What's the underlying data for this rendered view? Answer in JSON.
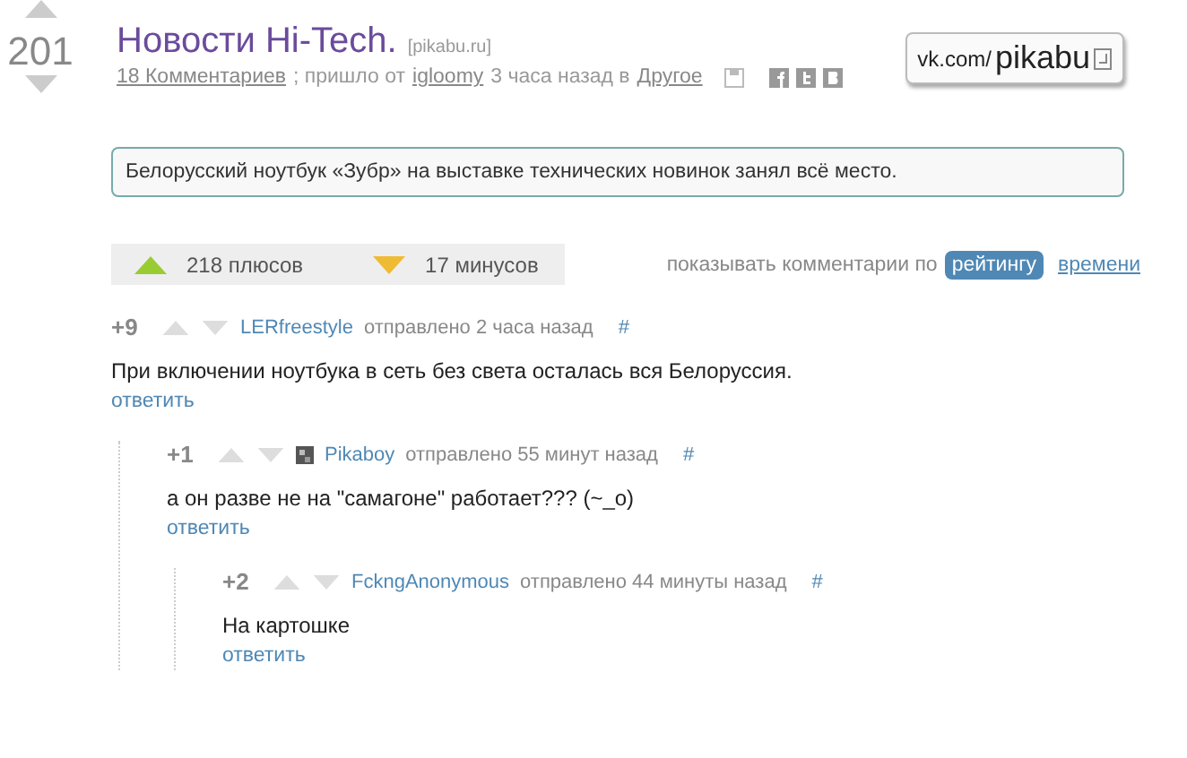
{
  "post": {
    "score": "201",
    "title": "Новости Hi-Tech.",
    "source": "[pikabu.ru]",
    "comments_link": "18 Комментариев",
    "came_from": "; пришло от",
    "author": "igloomy",
    "time": "3 часа назад в",
    "category": "Другое",
    "badge_domain": "vk.com/",
    "badge_name": "pikabu",
    "description": "Белорусский ноутбук «Зубр» на выставке технических новинок занял всё место."
  },
  "rating": {
    "plus": "218 плюсов",
    "minus": "17 минусов"
  },
  "sort": {
    "label": "показывать комментарии по",
    "options": [
      {
        "label": "рейтингу",
        "selected": true
      },
      {
        "label": "времени",
        "selected": false
      }
    ]
  },
  "comments": [
    {
      "score": "+9",
      "author": "LERfreestyle",
      "avatar": false,
      "meta": "отправлено 2 часа назад",
      "anchor": "#",
      "text": "При включении ноутбука в сеть без света осталась вся Белоруссия.",
      "reply": "ответить",
      "children": [
        {
          "score": "+1",
          "author": "Pikaboy",
          "avatar": true,
          "meta": "отправлено 55 минут назад",
          "anchor": "#",
          "text": "а он разве не на \"самагоне\" работает??? (~_o)",
          "reply": "ответить",
          "children": [
            {
              "score": "+2",
              "author": "FckngAnonymous",
              "avatar": false,
              "meta": "отправлено 44 минуты назад",
              "anchor": "#",
              "text": "На картошке",
              "reply": "ответить"
            }
          ]
        }
      ]
    }
  ]
}
